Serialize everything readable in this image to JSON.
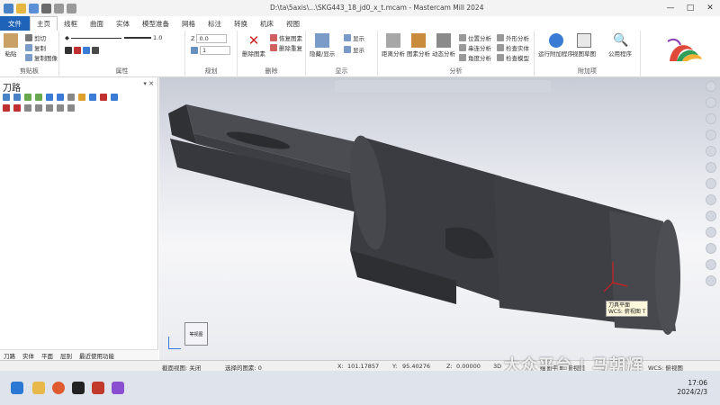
{
  "window": {
    "title": "D:\\ta\\5axis\\...\\SKG443_18_jd0_x_t.mcam - Mastercam Mill 2024",
    "controls": [
      "—",
      "□",
      "✕"
    ]
  },
  "tabs": [
    "文件",
    "主页",
    "线框",
    "曲面",
    "实体",
    "模型准备",
    "网格",
    "标注",
    "转换",
    "机床",
    "视图"
  ],
  "ribbon": {
    "clipboard": {
      "label": "剪贴板",
      "paste": "粘贴",
      "cut": "剪切",
      "copy": "复制",
      "copy_image": "复制图像"
    },
    "attributes": {
      "label": "属性",
      "line_width_value": "1.0"
    },
    "organize": {
      "label": "规划",
      "level_value": "1",
      "z_value": "0.0"
    },
    "delete": {
      "label": "删除",
      "delete_entities": "删除图素",
      "undelete": "恢复图素",
      "remove_dup": "删除重复"
    },
    "display": {
      "label": "显示",
      "show_hide": "隐藏/显示",
      "blank": "显示",
      "display_x": "显示"
    },
    "analyze": {
      "label": "分析",
      "distance": "距离分析",
      "entity_attrs": "图素分析",
      "dynamic": "动态分析",
      "pos": "位置分析",
      "chain": "串连分析",
      "angle": "角度分析",
      "contour": "外形分析",
      "check_solid": "检查实体",
      "check_model": "检查模型"
    },
    "addins": {
      "label": "附加项",
      "run_addin": "运行附加程序",
      "view_sketch": "视图草图",
      "search": "公用程序"
    }
  },
  "toolpath_panel": {
    "title": "刀路",
    "pin": "▾ ✕",
    "bottom_tabs": [
      "刀路",
      "实体",
      "平面",
      "层别",
      "最近使用功能"
    ]
  },
  "viewport": {
    "wcs_text": "刀具平面\nWCS: 俯视图 T",
    "view_label": "等视图",
    "viewcube_label": "等视图"
  },
  "statusbar": {
    "section": "截面视图: 关闭",
    "selected": "选择的图素: 0",
    "x_label": "X:",
    "x_value": "101.17857",
    "y_label": "Y:",
    "y_value": "95.40276",
    "z_label": "Z:",
    "z_value": "0.00000",
    "mode": "3D",
    "plane": "绘图平面: 俯视图",
    "tool_plane": "刀具平面: 俯视图",
    "wcs": "WCS: 俯视图"
  },
  "taskbar": {
    "time": "17:06",
    "date": "2024/2/3"
  },
  "watermark": "大众平台 | 马朝辉",
  "colors": {
    "accent": "#1e63b8",
    "part": "#3a3c41",
    "viewport_top": "#c8ccd6"
  }
}
